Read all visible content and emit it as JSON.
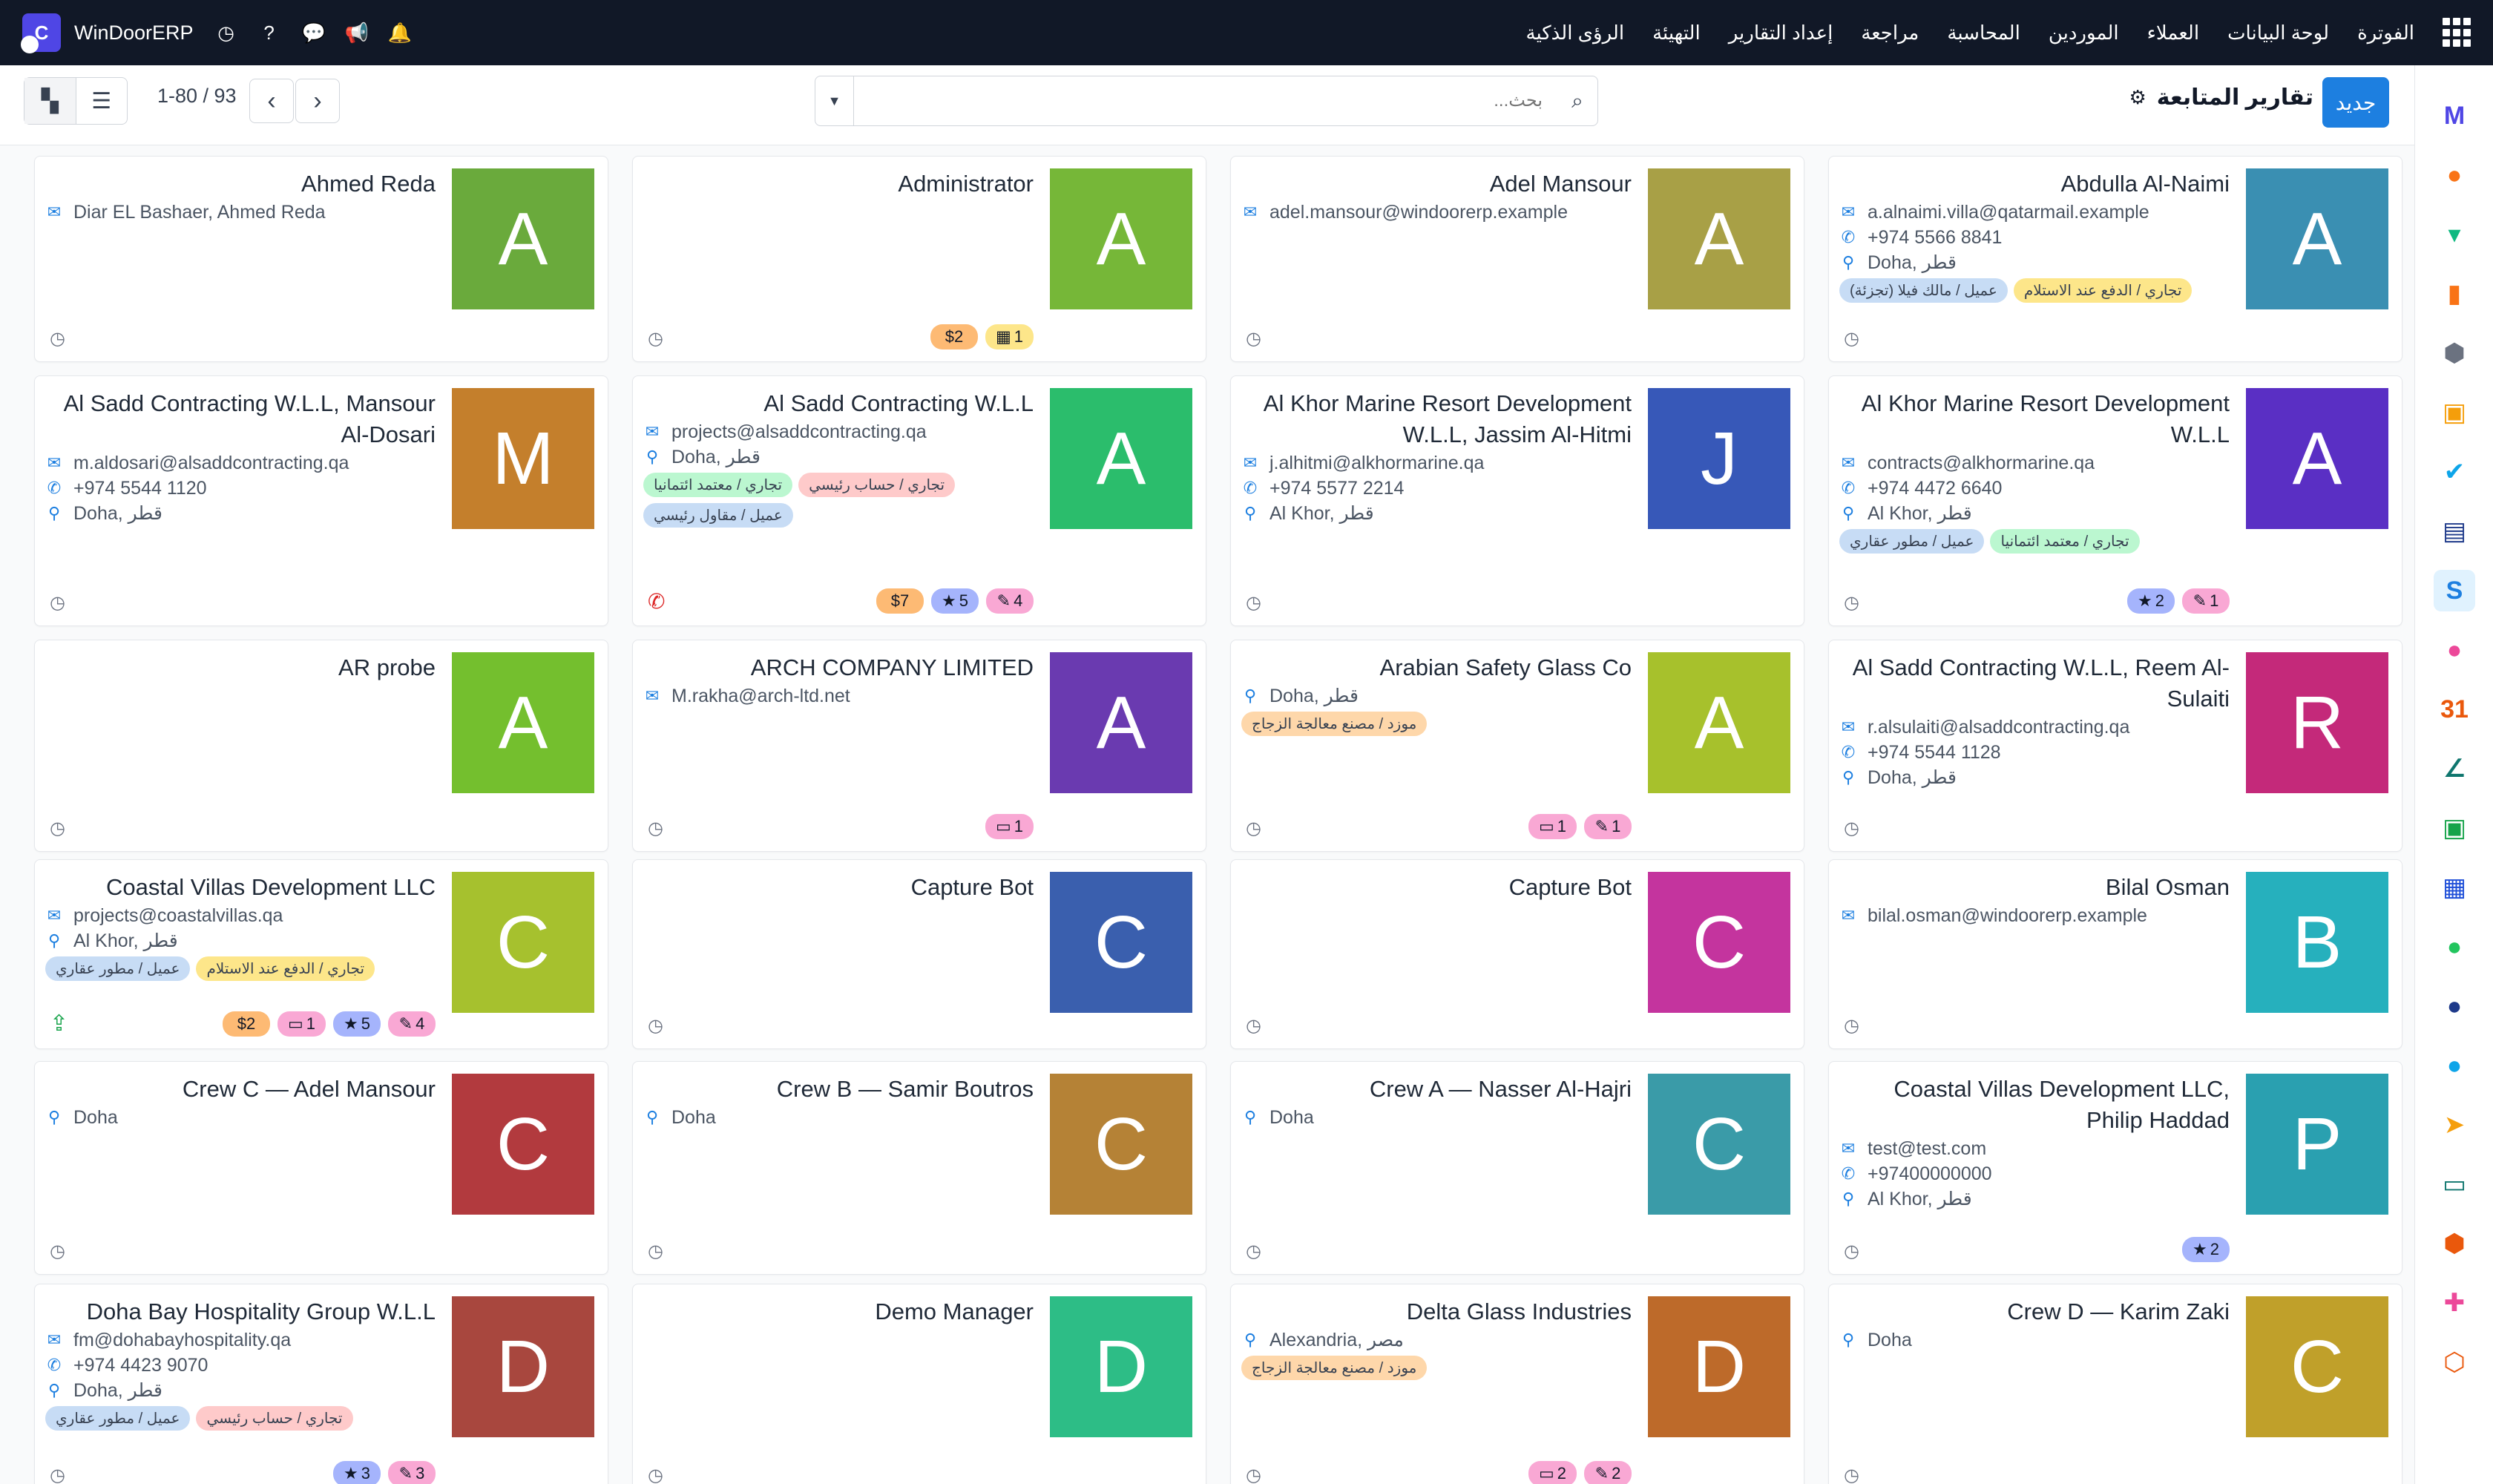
{
  "topbar": {
    "brand": "WinDoorERP",
    "menu": [
      "الفوترة",
      "لوحة البيانات",
      "العملاء",
      "الموردين",
      "المحاسبة",
      "مراجعة",
      "إعداد التقارير",
      "التهيئة",
      "الرؤى الذكية"
    ]
  },
  "control": {
    "new_label": "جديد",
    "title": "تقارير المتابعة",
    "search_placeholder": "بحث...",
    "pager": "1-80 / 93"
  },
  "colors": {
    "accent": "#1d7fe0",
    "topbar": "#111827"
  },
  "cards": [
    {
      "name": "Abdulla Al-Naimi",
      "initial": "A",
      "color": "#3a8fb2",
      "lines": [
        {
          "icon": "email",
          "text": "a.alnaimi.villa@qatarmail.example"
        },
        {
          "icon": "phone",
          "text": "+974 5566 8841"
        },
        {
          "icon": "pin",
          "text": "Doha, قطر"
        }
      ],
      "tags": [
        {
          "text": "تجاري / الدفع عند الاستلام",
          "color": "#fde68a"
        },
        {
          "text": "عميل / مالك فيلا (تجزئة)",
          "color": "#c7dcf5"
        }
      ],
      "badges": []
    },
    {
      "name": "Adel Mansour",
      "initial": "A",
      "color": "#a8a046",
      "lines": [
        {
          "icon": "email",
          "text": "adel.mansour@windoorerp.example"
        }
      ],
      "tags": [],
      "badges": []
    },
    {
      "name": "Administrator",
      "initial": "A",
      "color": "#76b738",
      "lines": [],
      "tags": [],
      "badges": [
        {
          "text": "$2",
          "color": "#fdba74"
        },
        {
          "text": "1",
          "icon": "cal",
          "color": "#fde68a"
        }
      ]
    },
    {
      "name": "Ahmed Reda",
      "initial": "A",
      "color": "#6aaa3c",
      "lines": [
        {
          "icon": "email",
          "text": "Diar EL Bashaer, Ahmed Reda"
        }
      ],
      "tags": [],
      "badges": []
    },
    {
      "name": "Al Khor Marine Resort Development W.L.L",
      "initial": "A",
      "color": "#5a2fc4",
      "lines": [
        {
          "icon": "email",
          "text": "contracts@alkhormarine.qa"
        },
        {
          "icon": "phone",
          "text": "+974 4472 6640"
        },
        {
          "icon": "pin",
          "text": "Al Khor, قطر"
        }
      ],
      "tags": [
        {
          "text": "تجاري / معتمد ائتمانيا",
          "color": "#bbf7d0"
        },
        {
          "text": "عميل / مطور عقاري",
          "color": "#c7dcf5"
        }
      ],
      "badges": [
        {
          "text": "2",
          "icon": "star",
          "color": "#a5b4fc"
        },
        {
          "text": "1",
          "icon": "edit",
          "color": "#f9a8d4"
        }
      ]
    },
    {
      "name": "Al Khor Marine Resort Development W.L.L, Jassim Al-Hitmi",
      "initial": "J",
      "color": "#3758b8",
      "sub": "A",
      "subcolor": "#5a2fc4",
      "lines": [
        {
          "icon": "email",
          "text": "j.alhitmi@alkhormarine.qa"
        },
        {
          "icon": "phone",
          "text": "+974 5577 2214"
        },
        {
          "icon": "pin",
          "text": "Al Khor, قطر"
        }
      ],
      "tags": [],
      "badges": []
    },
    {
      "name": "Al Sadd Contracting W.L.L",
      "initial": "A",
      "color": "#2bbd6c",
      "lines": [
        {
          "icon": "email",
          "text": "projects@alsaddcontracting.qa"
        },
        {
          "icon": "pin",
          "text": "Doha, قطر"
        }
      ],
      "tags": [
        {
          "text": "تجاري / حساب رئيسي",
          "color": "#fecaca"
        },
        {
          "text": "تجاري / معتمد ائتمانيا",
          "color": "#bbf7d0"
        },
        {
          "text": "عميل / مقاول رئيسي",
          "color": "#c7dcf5"
        }
      ],
      "badges": [
        {
          "text": "$7",
          "color": "#fdba74"
        },
        {
          "text": "5",
          "icon": "star",
          "color": "#a5b4fc"
        },
        {
          "text": "4",
          "icon": "edit",
          "color": "#f9a8d4"
        }
      ],
      "action": "phone"
    },
    {
      "name": "Al Sadd Contracting W.L.L, Mansour Al-Dosari",
      "initial": "M",
      "color": "#c47f2c",
      "sub": "A",
      "subcolor": "#2bbd6c",
      "lines": [
        {
          "icon": "email",
          "text": "m.aldosari@alsaddcontracting.qa"
        },
        {
          "icon": "phone",
          "text": "+974 5544 1120"
        },
        {
          "icon": "pin",
          "text": "Doha, قطر"
        }
      ],
      "tags": [],
      "badges": []
    },
    {
      "name": "Al Sadd Contracting W.L.L, Reem Al-Sulaiti",
      "initial": "R",
      "color": "#c4297a",
      "sub": "A",
      "subcolor": "#2bbd6c",
      "lines": [
        {
          "icon": "email",
          "text": "r.alsulaiti@alsaddcontracting.qa"
        },
        {
          "icon": "phone",
          "text": "+974 5544 1128"
        },
        {
          "icon": "pin",
          "text": "Doha, قطر"
        }
      ],
      "tags": [],
      "badges": []
    },
    {
      "name": "Arabian Safety Glass Co",
      "initial": "A",
      "color": "#a7c12c",
      "lines": [
        {
          "icon": "pin",
          "text": "Doha, قطر"
        }
      ],
      "tags": [
        {
          "text": "موزد / مصنع معالجة الزجاج",
          "color": "#fed7aa"
        }
      ],
      "badges": [
        {
          "text": "1",
          "icon": "card",
          "color": "#f9a8d4"
        },
        {
          "text": "1",
          "icon": "edit",
          "color": "#f9a8d4"
        }
      ]
    },
    {
      "name": "ARCH COMPANY LIMITED",
      "initial": "A",
      "color": "#6a3ab0",
      "lines": [
        {
          "icon": "email",
          "text": "M.rakha@arch-ltd.net"
        }
      ],
      "tags": [],
      "badges": [
        {
          "text": "1",
          "icon": "card",
          "color": "#f9a8d4"
        }
      ]
    },
    {
      "name": "AR probe",
      "initial": "A",
      "color": "#74bf2e",
      "lines": [],
      "tags": [],
      "badges": []
    },
    {
      "name": "Bilal Osman",
      "initial": "B",
      "color": "#26b0bd",
      "lines": [
        {
          "icon": "email",
          "text": "bilal.osman@windoorerp.example"
        }
      ],
      "tags": [],
      "badges": []
    },
    {
      "name": "Capture Bot",
      "initial": "C",
      "color": "#c4349e",
      "lines": [],
      "tags": [],
      "badges": []
    },
    {
      "name": "Capture Bot",
      "initial": "C",
      "color": "#3a5fae",
      "lines": [],
      "tags": [],
      "badges": []
    },
    {
      "name": "Coastal Villas Development LLC",
      "initial": "C",
      "color": "#a6c12e",
      "lines": [
        {
          "icon": "email",
          "text": "projects@coastalvillas.qa"
        },
        {
          "icon": "pin",
          "text": "Al Khor, قطر"
        }
      ],
      "tags": [
        {
          "text": "تجاري / الدفع عند الاستلام",
          "color": "#fde68a"
        },
        {
          "text": "عميل / مطور عقاري",
          "color": "#c7dcf5"
        }
      ],
      "badges": [
        {
          "text": "$2",
          "color": "#fdba74"
        },
        {
          "text": "1",
          "icon": "card",
          "color": "#f9a8d4"
        },
        {
          "text": "5",
          "icon": "star",
          "color": "#a5b4fc"
        },
        {
          "text": "4",
          "icon": "edit",
          "color": "#f9a8d4"
        }
      ],
      "action": "upload"
    },
    {
      "name": "Coastal Villas Development LLC, Philip Haddad",
      "initial": "P",
      "color": "#2aa0b0",
      "sub": "C",
      "subcolor": "#a6c12e",
      "lines": [
        {
          "icon": "email",
          "text": "test@test.com"
        },
        {
          "icon": "phone",
          "text": "+97400000000"
        },
        {
          "icon": "pin",
          "text": "Al Khor, قطر"
        }
      ],
      "tags": [],
      "badges": [
        {
          "text": "2",
          "icon": "star",
          "color": "#a5b4fc"
        }
      ]
    },
    {
      "name": "Crew A — Nasser Al-Hajri",
      "initial": "C",
      "color": "#3a9ba8",
      "lines": [
        {
          "icon": "pin",
          "text": "Doha"
        }
      ],
      "tags": [],
      "badges": []
    },
    {
      "name": "Crew B — Samir Boutros",
      "initial": "C",
      "color": "#b58236",
      "lines": [
        {
          "icon": "pin",
          "text": "Doha"
        }
      ],
      "tags": [],
      "badges": []
    },
    {
      "name": "Crew C — Adel Mansour",
      "initial": "C",
      "color": "#b23a3e",
      "lines": [
        {
          "icon": "pin",
          "text": "Doha"
        }
      ],
      "tags": [],
      "badges": []
    },
    {
      "name": "Crew D — Karim Zaki",
      "initial": "C",
      "color": "#c0a02a",
      "lines": [
        {
          "icon": "pin",
          "text": "Doha"
        }
      ],
      "tags": [],
      "badges": []
    },
    {
      "name": "Delta Glass Industries",
      "initial": "D",
      "color": "#bd6a2a",
      "lines": [
        {
          "icon": "pin",
          "text": "Alexandria, مصر"
        }
      ],
      "tags": [
        {
          "text": "موزد / مصنع معالجة الزجاج",
          "color": "#fed7aa"
        }
      ],
      "badges": [
        {
          "text": "2",
          "icon": "card",
          "color": "#f9a8d4"
        },
        {
          "text": "2",
          "icon": "edit",
          "color": "#f9a8d4"
        }
      ]
    },
    {
      "name": "Demo Manager",
      "initial": "D",
      "color": "#2dbd86",
      "lines": [],
      "tags": [],
      "badges": []
    },
    {
      "name": "Doha Bay Hospitality Group W.L.L",
      "initial": "D",
      "color": "#a8473e",
      "lines": [
        {
          "icon": "email",
          "text": "fm@dohabayhospitality.qa"
        },
        {
          "icon": "phone",
          "text": "+974 4423 9070"
        },
        {
          "icon": "pin",
          "text": "Doha, قطر"
        }
      ],
      "tags": [
        {
          "text": "تجاري / حساب رئيسي",
          "color": "#fecaca"
        },
        {
          "text": "عميل / مطور عقاري",
          "color": "#c7dcf5"
        }
      ],
      "badges": [
        {
          "text": "3",
          "icon": "star",
          "color": "#a5b4fc"
        },
        {
          "text": "3",
          "icon": "edit",
          "color": "#f9a8d4"
        }
      ]
    }
  ],
  "sidepanel": [
    {
      "icon": "M",
      "color": "#4f46e5"
    },
    {
      "icon": "●",
      "color": "#f97316"
    },
    {
      "icon": "▾",
      "color": "#10b981"
    },
    {
      "icon": "▮",
      "color": "#f97316"
    },
    {
      "icon": "⬢",
      "color": "#6b7280"
    },
    {
      "icon": "▣",
      "color": "#f59e0b"
    },
    {
      "icon": "✔",
      "color": "#0ea5e9"
    },
    {
      "icon": "▤",
      "color": "#1e3a8a"
    },
    {
      "icon": "S",
      "color": "#1d7fe0"
    },
    {
      "icon": "●",
      "color": "#ec4899"
    },
    {
      "icon": "31",
      "color": "#ea580c"
    },
    {
      "icon": "∠",
      "color": "#0f766e"
    },
    {
      "icon": "▣",
      "color": "#16a34a"
    },
    {
      "icon": "▦",
      "color": "#1d4ed8"
    },
    {
      "icon": "●",
      "color": "#22c55e"
    },
    {
      "icon": "●",
      "color": "#1e3a8a"
    },
    {
      "icon": "●",
      "color": "#0ea5e9"
    },
    {
      "icon": "➤",
      "color": "#f59e0b"
    },
    {
      "icon": "▭",
      "color": "#0f766e"
    },
    {
      "icon": "⬢",
      "color": "#ea580c"
    },
    {
      "icon": "✚",
      "color": "#ec4899"
    },
    {
      "icon": "⬡",
      "color": "#ea580c"
    }
  ]
}
